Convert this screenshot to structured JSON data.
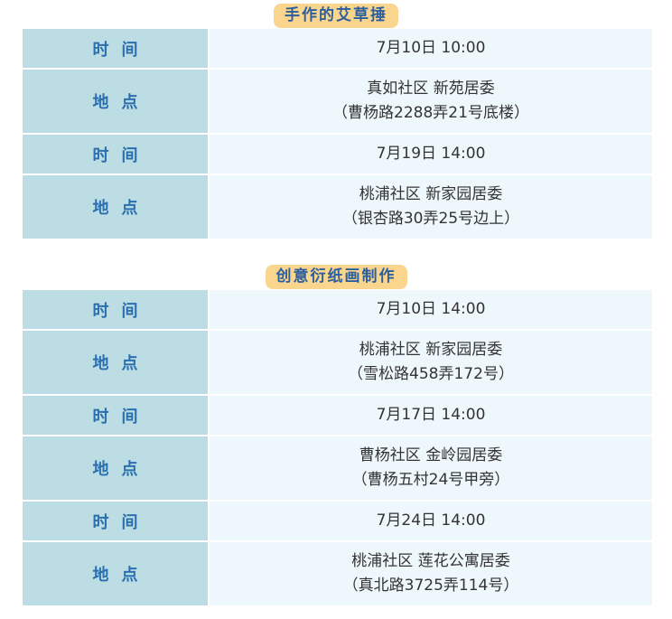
{
  "sections": [
    {
      "title": "手作的艾草捶",
      "rows": [
        {
          "label": "时间",
          "lines": [
            "7月10日 10:00"
          ]
        },
        {
          "label": "地点",
          "lines": [
            "真如社区 新苑居委",
            "（曹杨路2288弄21号底楼）"
          ]
        },
        {
          "label": "时间",
          "lines": [
            "7月19日 14:00"
          ]
        },
        {
          "label": "地点",
          "lines": [
            "桃浦社区 新家园居委",
            "（银杏路30弄25号边上）"
          ]
        }
      ]
    },
    {
      "title": "创意衍纸画制作",
      "rows": [
        {
          "label": "时间",
          "lines": [
            "7月10日 14:00"
          ]
        },
        {
          "label": "地点",
          "lines": [
            "桃浦社区 新家园居委",
            "（雪松路458弄172号）"
          ]
        },
        {
          "label": "时间",
          "lines": [
            "7月17日 14:00"
          ]
        },
        {
          "label": "地点",
          "lines": [
            "曹杨社区 金岭园居委",
            "（曹杨五村24号甲旁）"
          ]
        },
        {
          "label": "时间",
          "lines": [
            "7月24日 14:00"
          ]
        },
        {
          "label": "地点",
          "lines": [
            "桃浦社区 莲花公寓居委",
            "（真北路3725弄114号）"
          ]
        }
      ]
    }
  ]
}
